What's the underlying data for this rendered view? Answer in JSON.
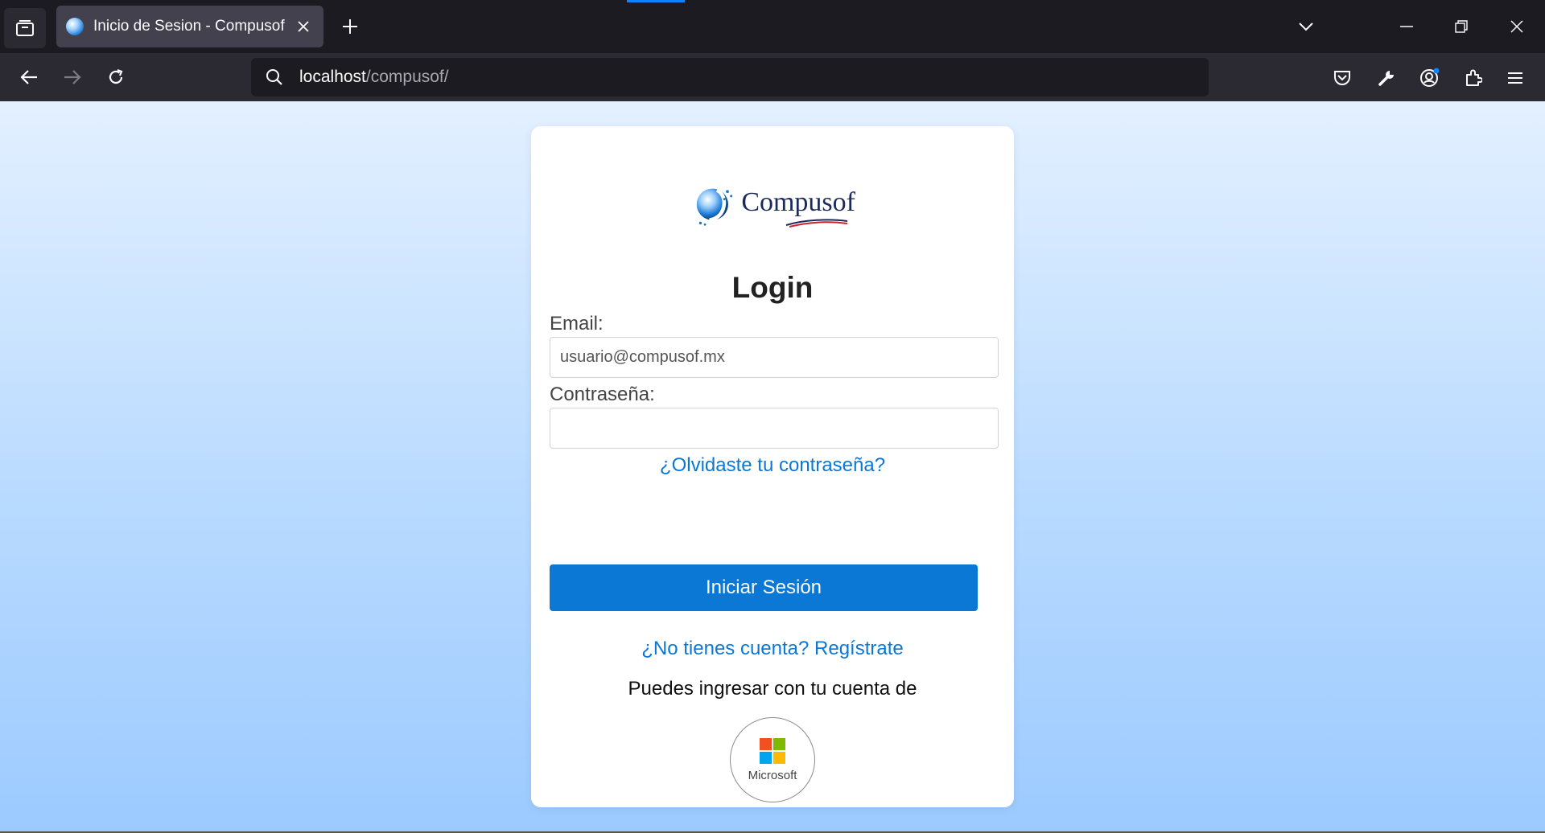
{
  "browser": {
    "tab": {
      "title": "Inicio de Sesion - Compusof"
    },
    "url": {
      "host": "localhost",
      "path": "/compusof/"
    }
  },
  "page": {
    "logo_text": "Compusof",
    "title": "Login",
    "email": {
      "label": "Email:",
      "value": "usuario@compusof.mx"
    },
    "password": {
      "label": "Contraseña:",
      "value": ""
    },
    "forgot_link": "¿Olvidaste tu contraseña?",
    "submit_label": "Iniciar Sesión",
    "register_link": "¿No tienes cuenta? Regístrate",
    "alt_login_prompt": "Puedes ingresar con tu cuenta de",
    "microsoft_label": "Microsoft"
  },
  "colors": {
    "accent": "#0a78d4",
    "ms_red": "#f25022",
    "ms_green": "#7fba00",
    "ms_blue": "#00a4ef",
    "ms_yellow": "#ffb900"
  }
}
